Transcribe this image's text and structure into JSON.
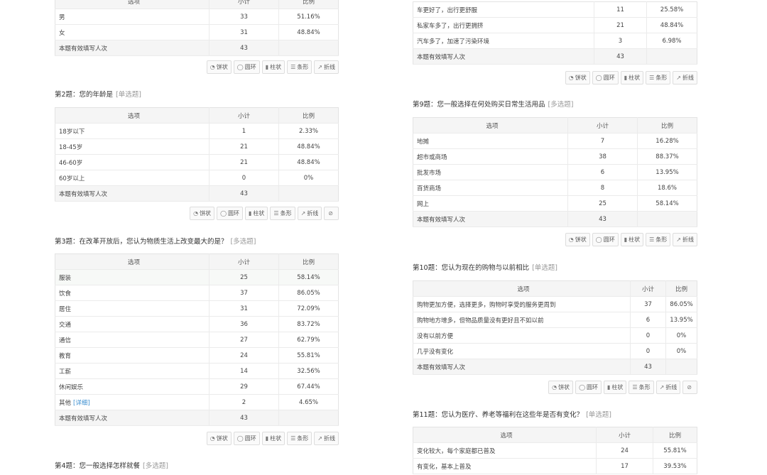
{
  "toolbar": {
    "pie": "饼状",
    "ring": "圆环",
    "bar": "柱状",
    "hbar": "条形",
    "line": "折线"
  },
  "header": {
    "option": "选项",
    "count": "小计",
    "ratio": "比例"
  },
  "total_label": "本题有效填写人次",
  "left": {
    "q_gender": {
      "rows": [
        {
          "option": "男",
          "count": "33",
          "ratio": "51.16%"
        },
        {
          "option": "女",
          "count": "31",
          "ratio": "48.84%"
        }
      ],
      "total": "43"
    },
    "q_age": {
      "title": "第2题：您的年龄是",
      "type": "[单选题]",
      "rows": [
        {
          "option": "18岁以下",
          "count": "1",
          "ratio": "2.33%"
        },
        {
          "option": "18-45岁",
          "count": "21",
          "ratio": "48.84%"
        },
        {
          "option": "46-60岁",
          "count": "21",
          "ratio": "48.84%"
        },
        {
          "option": "60岁以上",
          "count": "0",
          "ratio": "0%"
        }
      ],
      "total": "43"
    },
    "q_change": {
      "title": "第3题：在改革开放后，您认为物质生活上改变最大的是？",
      "type": "[多选题]",
      "rows": [
        {
          "option": "服装",
          "count": "25",
          "ratio": "58.14%"
        },
        {
          "option": "饮食",
          "count": "37",
          "ratio": "86.05%"
        },
        {
          "option": "居住",
          "count": "31",
          "ratio": "72.09%"
        },
        {
          "option": "交通",
          "count": "36",
          "ratio": "83.72%"
        },
        {
          "option": "通信",
          "count": "27",
          "ratio": "62.79%"
        },
        {
          "option": "教育",
          "count": "24",
          "ratio": "55.81%"
        },
        {
          "option": "工薪",
          "count": "14",
          "ratio": "32.56%"
        },
        {
          "option": "休闲娱乐",
          "count": "29",
          "ratio": "67.44%"
        },
        {
          "option": "其他",
          "detail": "[详细]",
          "count": "2",
          "ratio": "4.65%"
        }
      ],
      "total": "43"
    },
    "q_dining": {
      "title": "第4题：您一般选择怎样就餐",
      "type": "[多选题]"
    }
  },
  "right": {
    "q_travel": {
      "rows": [
        {
          "option": "车更好了，出行更舒服",
          "count": "11",
          "ratio": "25.58%"
        },
        {
          "option": "私家车多了，出行更拥挤",
          "count": "21",
          "ratio": "48.84%"
        },
        {
          "option": "汽车多了，加速了污染环境",
          "count": "3",
          "ratio": "6.98%"
        }
      ],
      "total": "43"
    },
    "q_shop": {
      "title": "第9题：您一般选择在何处购买日常生活用品",
      "type": "[多选题]",
      "rows": [
        {
          "option": "地摊",
          "count": "7",
          "ratio": "16.28%"
        },
        {
          "option": "超市或商场",
          "count": "38",
          "ratio": "88.37%"
        },
        {
          "option": "批发市场",
          "count": "6",
          "ratio": "13.95%"
        },
        {
          "option": "百货商场",
          "count": "8",
          "ratio": "18.6%"
        },
        {
          "option": "网上",
          "count": "25",
          "ratio": "58.14%"
        }
      ],
      "total": "43"
    },
    "q_compare": {
      "title": "第10题：您认为现在的购物与以前相比",
      "type": "[单选题]",
      "rows": [
        {
          "option": "购物更加方便，选择更多，购物时享受的服务更周到",
          "count": "37",
          "ratio": "86.05%"
        },
        {
          "option": "购物地方增多，但物品质量没有更好且不如以前",
          "count": "6",
          "ratio": "13.95%"
        },
        {
          "option": "没有以前方便",
          "count": "0",
          "ratio": "0%"
        },
        {
          "option": "几乎没有变化",
          "count": "0",
          "ratio": "0%"
        }
      ],
      "total": "43"
    },
    "q_welfare": {
      "title": "第11题：您认为医疗、养老等福利在这些年是否有变化？",
      "type": "[单选题]",
      "rows": [
        {
          "option": "变化较大，每个家庭都已普及",
          "count": "24",
          "ratio": "55.81%"
        },
        {
          "option": "有变化，基本上普及",
          "count": "17",
          "ratio": "39.53%"
        }
      ]
    }
  }
}
